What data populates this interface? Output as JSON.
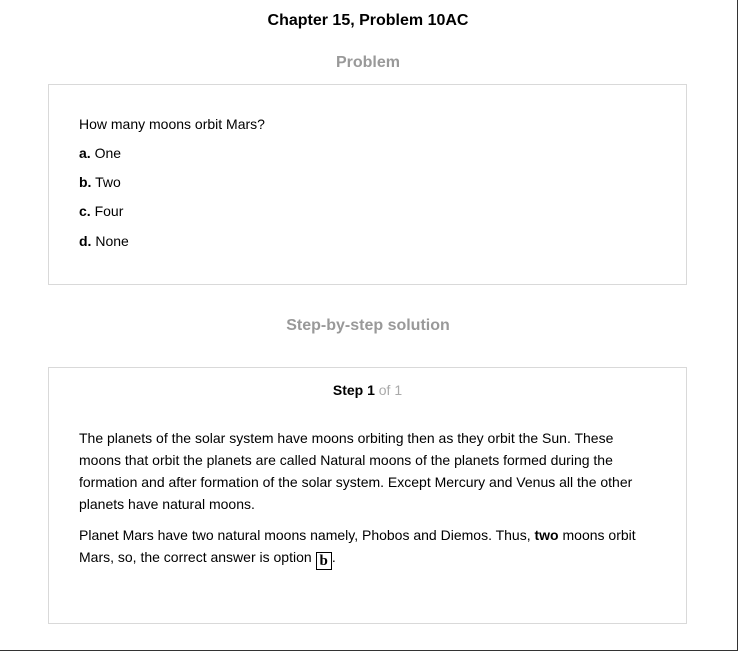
{
  "page": {
    "title": "Chapter 15, Problem 10AC"
  },
  "problem": {
    "heading": "Problem",
    "question": "How many moons orbit Mars?",
    "options": [
      {
        "letter": "a.",
        "text": "One"
      },
      {
        "letter": "b.",
        "text": "Two"
      },
      {
        "letter": "c.",
        "text": "Four"
      },
      {
        "letter": "d.",
        "text": "None"
      }
    ]
  },
  "solution": {
    "heading": "Step-by-step solution",
    "step_label": "Step 1",
    "step_of": "of 1",
    "paragraph1": "The planets of the solar system have moons orbiting then as they orbit the Sun. These moons that orbit the planets are called Natural moons of the planets formed during the formation and after formation of the solar system. Except Mercury and Venus all the other planets have natural moons.",
    "paragraph2_before": "Planet Mars have two natural moons namely, Phobos and Diemos. Thus, ",
    "paragraph2_bold": "two",
    "paragraph2_middle": " moons orbit Mars, so, the correct answer is option ",
    "answer": "b",
    "paragraph2_end": "."
  }
}
